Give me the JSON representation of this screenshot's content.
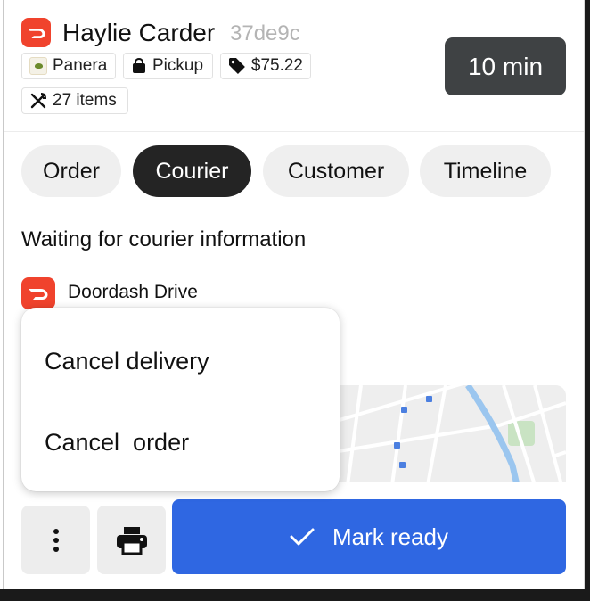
{
  "header": {
    "customer_name": "Haylie Carder",
    "order_code": "37de9c",
    "store": "Panera",
    "fulfillment": "Pickup",
    "price": "$75.22",
    "items": "27 items",
    "eta": "10 min"
  },
  "tabs": [
    {
      "label": "Order",
      "active": false
    },
    {
      "label": "Courier",
      "active": true
    },
    {
      "label": "Customer",
      "active": false
    },
    {
      "label": "Timeline",
      "active": false
    }
  ],
  "courier": {
    "status": "Waiting for courier information",
    "provider": "Doordash Drive"
  },
  "menu": {
    "cancel_delivery": "Cancel delivery",
    "cancel_order": "Cancel  order"
  },
  "footer": {
    "mark_ready": "Mark ready"
  },
  "colors": {
    "brand": "#f0432d",
    "primary_button": "#2f67e2",
    "active_tab": "#242424",
    "eta_button": "#3f4244"
  },
  "icons": {
    "brand": "doordash-icon",
    "pickup": "shopping-bag-icon",
    "price": "price-tag-icon",
    "items": "utensils-icon",
    "more": "more-vertical-icon",
    "print": "printer-icon",
    "check": "check-icon"
  }
}
